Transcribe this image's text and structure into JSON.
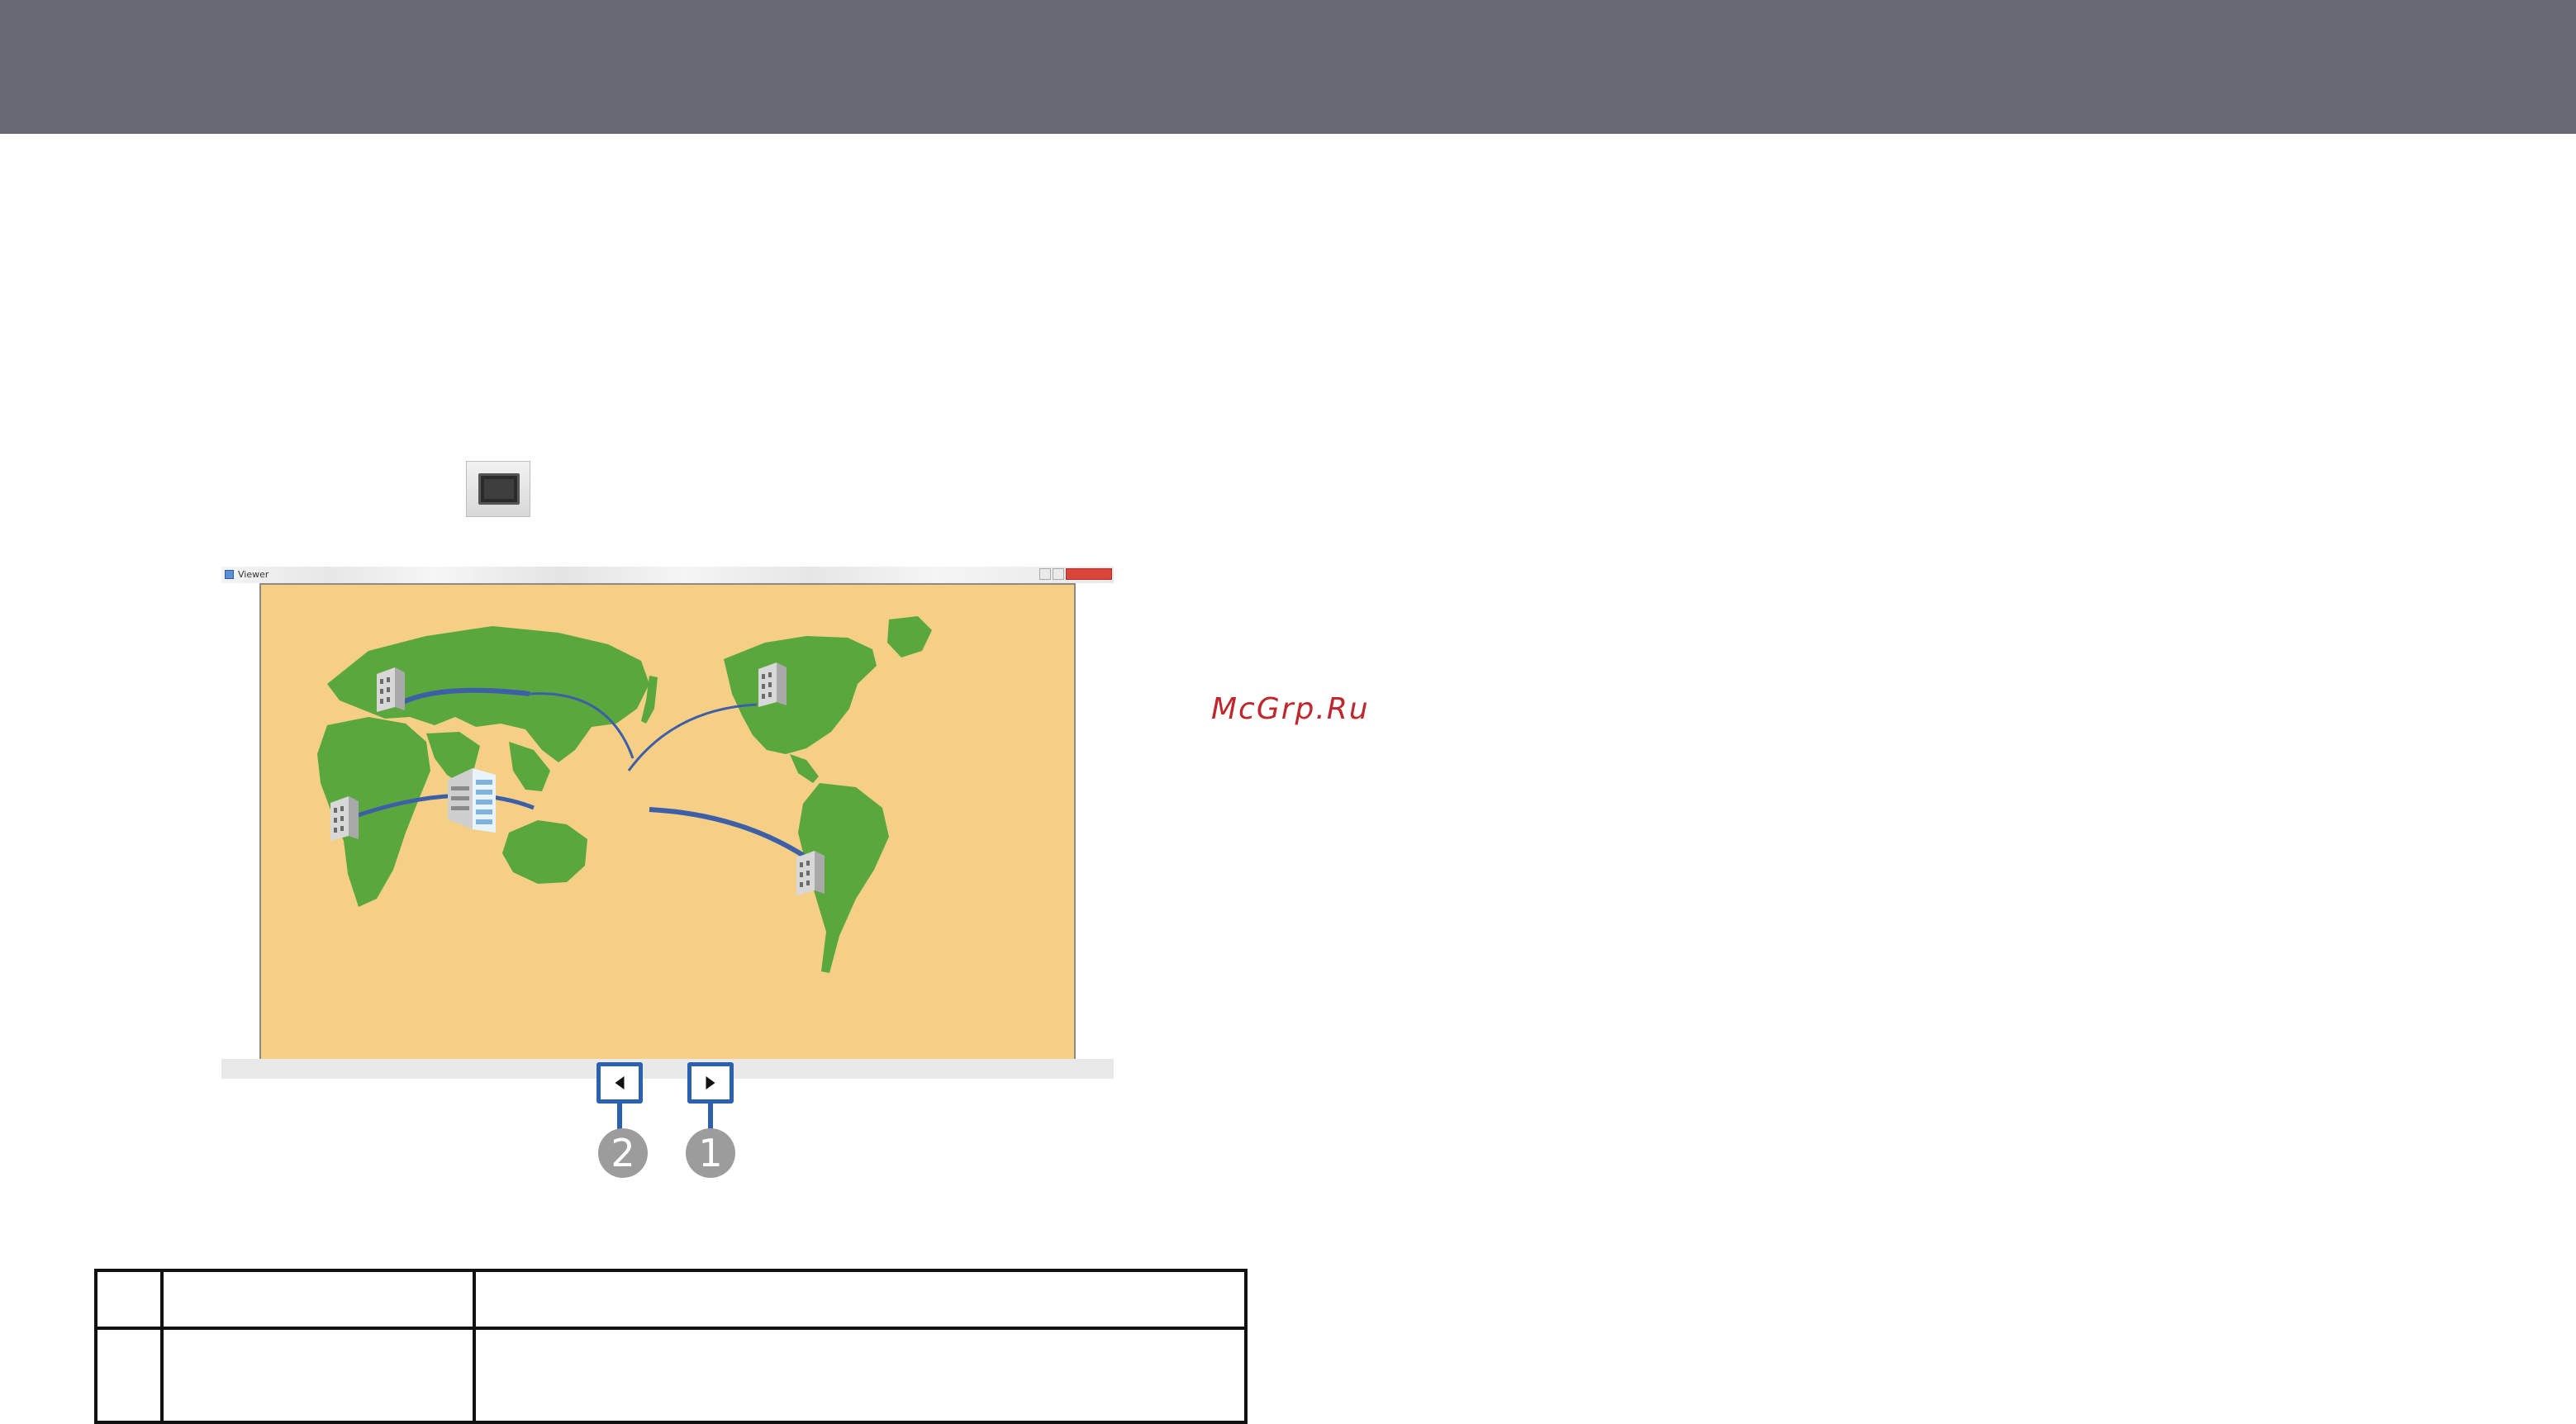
{
  "viewer_window": {
    "title": "Viewer"
  },
  "callouts": {
    "next": "1",
    "previous": "2"
  },
  "watermark": "McGrp.Ru",
  "icons": {
    "viewer_toolbar_icon": "monitor-icon",
    "previous_page": "triangle-left-icon",
    "next_page": "triangle-right-icon"
  },
  "colors": {
    "header_bar": "#676a74",
    "slide_background": "#f4cf85",
    "land": "#5aa83d",
    "callout_border": "#2b61ae",
    "callout_badge": "#9c9c9c",
    "watermark": "#c0262c"
  }
}
